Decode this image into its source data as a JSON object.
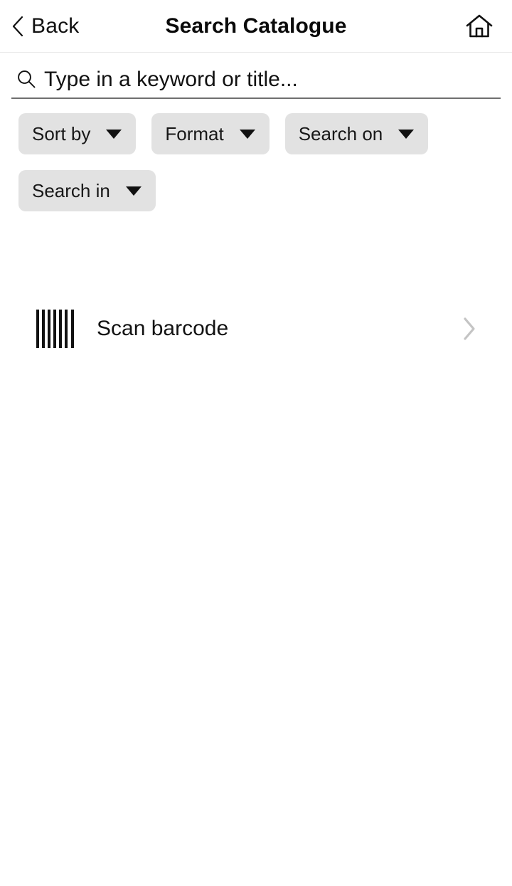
{
  "header": {
    "back_label": "Back",
    "back_icon": "chevron-left-icon",
    "title": "Search Catalogue",
    "home_icon": "home-icon"
  },
  "search": {
    "icon": "search-icon",
    "placeholder": "Type in a keyword or title...",
    "value": ""
  },
  "filters": {
    "chips": [
      {
        "label": "Sort by",
        "caret_icon": "chevron-down-icon"
      },
      {
        "label": "Format",
        "caret_icon": "chevron-down-icon"
      },
      {
        "label": "Search on",
        "caret_icon": "chevron-down-icon"
      },
      {
        "label": "Search in",
        "caret_icon": "chevron-down-icon"
      }
    ]
  },
  "scan": {
    "icon": "barcode-icon",
    "label": "Scan barcode",
    "chevron_icon": "chevron-right-icon"
  },
  "colors": {
    "background": "#ffffff",
    "text": "#111111",
    "chip_background": "#e2e2e2",
    "divider": "#e9e9e9",
    "underline": "#6f6f6f",
    "chevron_muted": "#c4c4c4"
  }
}
